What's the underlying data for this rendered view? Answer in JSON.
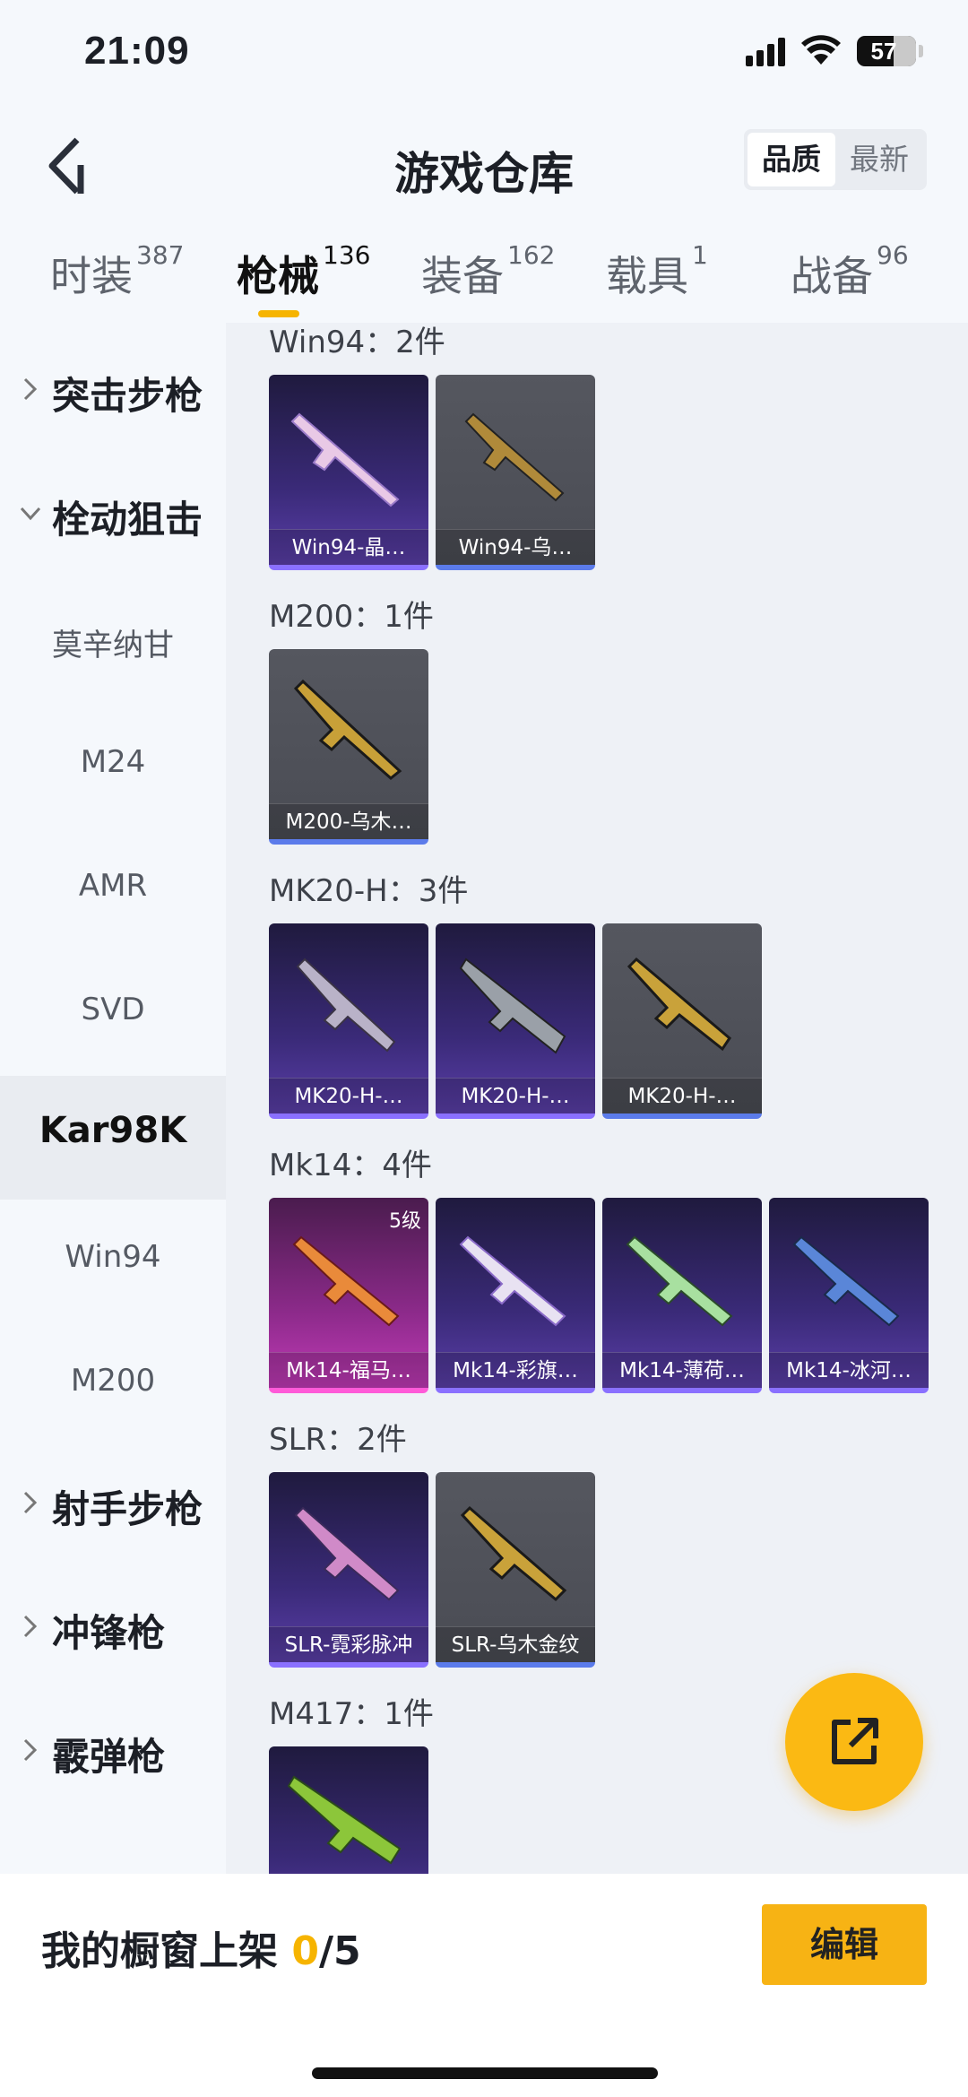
{
  "status": {
    "time": "21:09",
    "battery": "57"
  },
  "header": {
    "title": "游戏仓库",
    "sort_quality": "品质",
    "sort_newest": "最新"
  },
  "tabs": [
    {
      "label": "时装",
      "count": "387"
    },
    {
      "label": "枪械",
      "count": "136"
    },
    {
      "label": "装备",
      "count": "162"
    },
    {
      "label": "载具",
      "count": "1"
    },
    {
      "label": "战备",
      "count": "96"
    }
  ],
  "sidebar": {
    "items": [
      {
        "label": "突击步枪"
      },
      {
        "label": "栓动狙击"
      },
      {
        "label": "莫辛纳甘"
      },
      {
        "label": "M24"
      },
      {
        "label": "AMR"
      },
      {
        "label": "SVD"
      },
      {
        "label": "Kar98K"
      },
      {
        "label": "Win94"
      },
      {
        "label": "M200"
      },
      {
        "label": "射手步枪"
      },
      {
        "label": "冲锋枪"
      },
      {
        "label": "霰弹枪"
      }
    ]
  },
  "groups": [
    {
      "title": "Win94：2件",
      "cards": [
        {
          "label": "Win94-晶…"
        },
        {
          "label": "Win94-乌…"
        }
      ]
    },
    {
      "title": "M200：1件",
      "cards": [
        {
          "label": "M200-乌木…"
        }
      ]
    },
    {
      "title": "MK20-H：3件",
      "cards": [
        {
          "label": "MK20-H-…"
        },
        {
          "label": "MK20-H-…"
        },
        {
          "label": "MK20-H-…"
        }
      ]
    },
    {
      "title": "Mk14：4件",
      "cards": [
        {
          "label": "Mk14-福马…",
          "level": "5级"
        },
        {
          "label": "Mk14-彩旗…"
        },
        {
          "label": "Mk14-薄荷…"
        },
        {
          "label": "Mk14-冰河…"
        }
      ]
    },
    {
      "title": "SLR：2件",
      "cards": [
        {
          "label": "SLR-霓彩脉冲"
        },
        {
          "label": "SLR-乌木金纹"
        }
      ]
    },
    {
      "title": "M417：1件",
      "cards": [
        {
          "label": ""
        }
      ]
    }
  ],
  "bottom": {
    "showcase_label": "我的橱窗上架 ",
    "showcase_current": "0",
    "showcase_total": "/5",
    "edit": "编辑"
  },
  "colors": {
    "accent": "#f6b400",
    "purple_card": "#3a2a78",
    "gray_card": "#4a4c54",
    "pink_card": "#8c2a8a"
  }
}
